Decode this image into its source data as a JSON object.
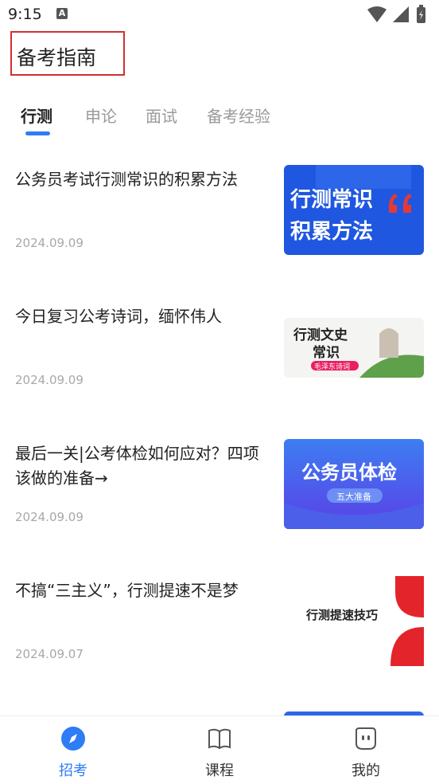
{
  "status": {
    "time": "9:15",
    "notif_letter": "A"
  },
  "header": {
    "title": "备考指南"
  },
  "tabs": [
    {
      "label": "行测",
      "active": true
    },
    {
      "label": "申论",
      "active": false
    },
    {
      "label": "面试",
      "active": false
    },
    {
      "label": "备考经验",
      "active": false
    }
  ],
  "articles": [
    {
      "title": "公务员考试行测常识的积累方法",
      "date": "2024.09.09",
      "thumb": {
        "line1": "行测常识",
        "line2": "积累方法"
      }
    },
    {
      "title": "今日复习公考诗词，缅怀伟人",
      "date": "2024.09.09",
      "thumb": {
        "line1": "行测文史",
        "line2": "常识",
        "tag": "毛泽东诗词"
      }
    },
    {
      "title": "最后一关|公考体检如何应对？四项该做的准备→",
      "date": "2024.09.09",
      "thumb": {
        "line1": "公务员体检",
        "tag": "五大准备"
      }
    },
    {
      "title": "不搞“三主义”，行测提速不是梦",
      "date": "2024.09.07",
      "thumb": {
        "line1": "行测提速技巧"
      }
    }
  ],
  "bottom_nav": [
    {
      "label": "招考",
      "icon": "compass-icon",
      "active": true
    },
    {
      "label": "课程",
      "icon": "book-icon",
      "active": false
    },
    {
      "label": "我的",
      "icon": "face-icon",
      "active": false
    }
  ],
  "colors": {
    "accent": "#2e7cf6",
    "title_box_border": "#d32f2f",
    "date": "#a8a8a8"
  }
}
